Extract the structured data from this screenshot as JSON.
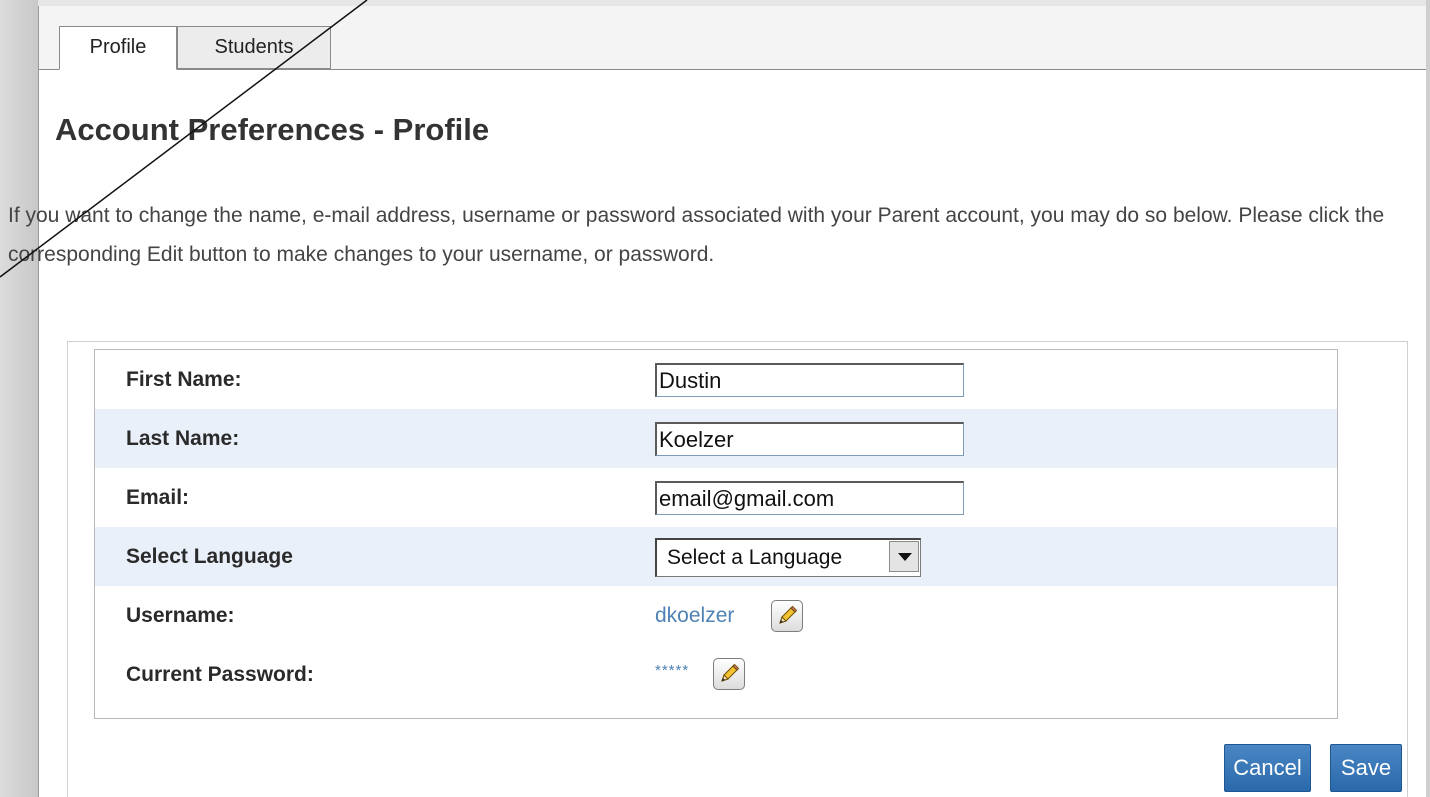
{
  "tabs": [
    {
      "label": "Profile",
      "active": true
    },
    {
      "label": "Students",
      "active": false
    }
  ],
  "page_title": "Account Preferences - Profile",
  "intro_text": "If you want to change the name, e-mail address, username or password associated with your Parent account, you may do so below. Please click the corresponding Edit button to make changes to your username, or password.",
  "form": {
    "first_name": {
      "label": "First Name:",
      "value": "Dustin"
    },
    "last_name": {
      "label": "Last Name:",
      "value": "Koelzer"
    },
    "email": {
      "label": "Email:",
      "value": "email@gmail.com"
    },
    "language": {
      "label": "Select Language",
      "selected": "Select a Language"
    },
    "username": {
      "label": "Username:",
      "value": "dkoelzer",
      "edit_icon": "pencil-icon"
    },
    "password": {
      "label": "Current Password:",
      "value": "*****",
      "edit_icon": "pencil-icon"
    }
  },
  "buttons": {
    "cancel_label": "Cancel",
    "save_label": "Save"
  },
  "colors": {
    "accent": "#2a69ab",
    "link": "#4f82b5",
    "alt_row": "#eaf0f9"
  }
}
